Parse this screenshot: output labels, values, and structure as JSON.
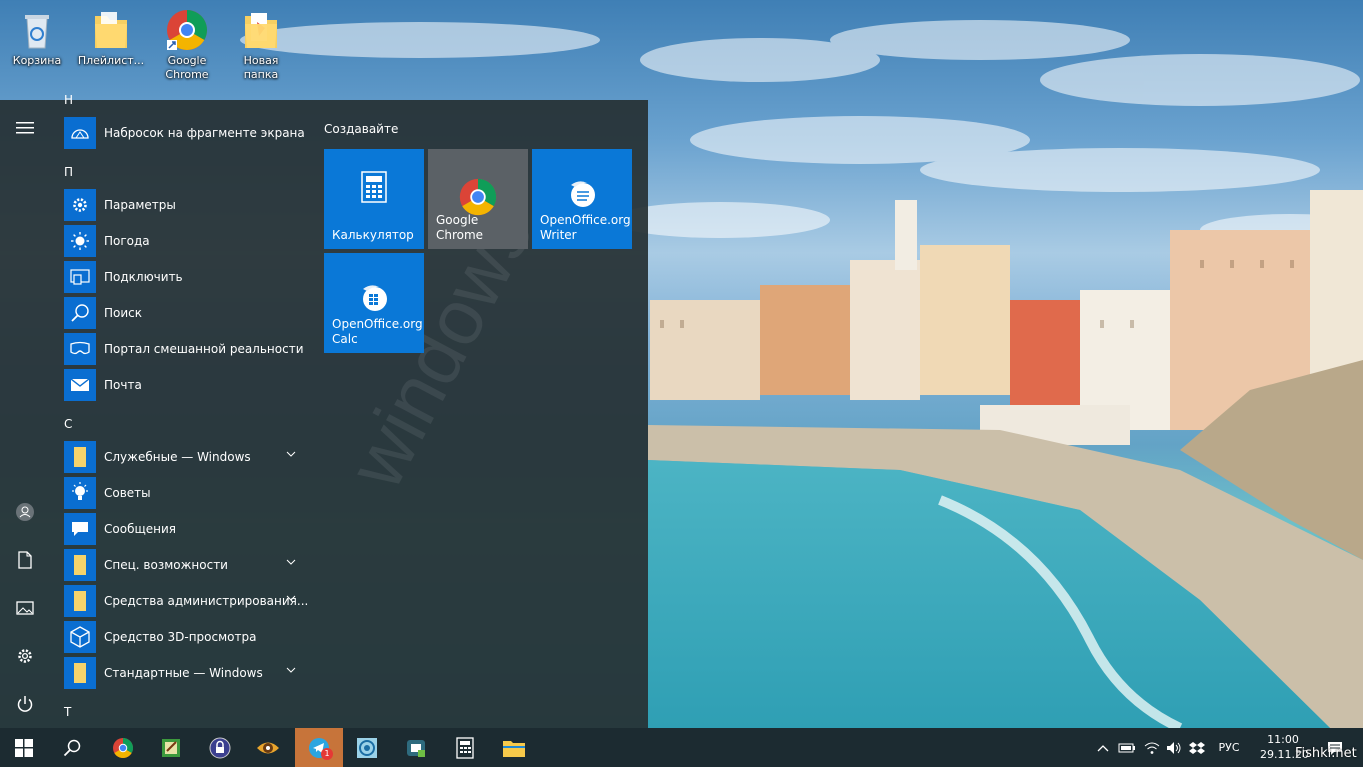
{
  "desktop": {
    "icons": [
      {
        "label": "Корзина"
      },
      {
        "label": "Плейлист..."
      },
      {
        "label": "Google Chrome"
      },
      {
        "label": "Новая папка"
      }
    ]
  },
  "start_menu": {
    "sections": [
      {
        "letter": "Н",
        "apps": [
          {
            "label": "Набросок на фрагменте экрана",
            "icon": "snip-sketch-icon"
          }
        ]
      },
      {
        "letter": "П",
        "apps": [
          {
            "label": "Параметры",
            "icon": "gear-icon"
          },
          {
            "label": "Погода",
            "icon": "sun-icon"
          },
          {
            "label": "Подключить",
            "icon": "connect-icon"
          },
          {
            "label": "Поиск",
            "icon": "search-icon"
          },
          {
            "label": "Портал смешанной реальности",
            "icon": "mixed-reality-icon"
          },
          {
            "label": "Почта",
            "icon": "mail-icon"
          }
        ]
      },
      {
        "letter": "С",
        "apps": [
          {
            "label": "Служебные — Windows",
            "icon": "folder-icon",
            "expandable": true
          },
          {
            "label": "Советы",
            "icon": "lightbulb-icon"
          },
          {
            "label": "Сообщения",
            "icon": "chat-icon"
          },
          {
            "label": "Спец. возможности",
            "icon": "folder-icon",
            "expandable": true
          },
          {
            "label": "Средства администрирования...",
            "icon": "folder-icon",
            "expandable": true
          },
          {
            "label": "Средство 3D-просмотра",
            "icon": "cube-icon"
          },
          {
            "label": "Стандартные — Windows",
            "icon": "folder-icon",
            "expandable": true
          }
        ]
      },
      {
        "letter": "Т",
        "apps": []
      }
    ],
    "tiles_group_title": "Создавайте",
    "tiles": [
      {
        "label": "Калькулятор",
        "icon": "calculator-icon",
        "color": "#0a78d7"
      },
      {
        "label": "Google Chrome",
        "icon": "chrome-icon",
        "color": "#5b6166"
      },
      {
        "label": "OpenOffice.org Writer",
        "icon": "openoffice-writer-icon",
        "color": "#0a78d7"
      },
      {
        "label": "OpenOffice.org Calc",
        "icon": "openoffice-calc-icon",
        "color": "#0a78d7"
      }
    ],
    "watermark": "windows"
  },
  "taskbar": {
    "pinned": [
      "start-icon",
      "search-icon",
      "chrome-icon",
      "notepad-icon",
      "lock-app-icon",
      "eye-app-icon",
      "telegram-icon",
      "camera-app-icon",
      "store-icon",
      "calculator-icon",
      "folder-icon"
    ],
    "telegram_badge": "1",
    "tray": {
      "language": "РУС",
      "time": "11:00",
      "date": "29.11.20"
    }
  },
  "watermark_site": "Fishki.net",
  "colors": {
    "accent": "#0a78d7",
    "taskbar": "#1c2b31",
    "active_app": "#c7743a"
  }
}
